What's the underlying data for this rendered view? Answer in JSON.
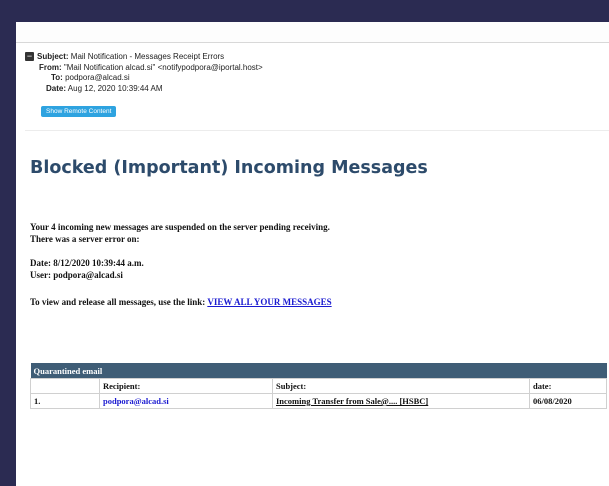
{
  "email": {
    "subject_label": "Subject:",
    "subject": "Mail Notification - Messages Receipt Errors",
    "from_label": "From:",
    "from": "\"Mail Notification alcad.si\" <notifypodpora@iportal.host>",
    "to_label": "To:",
    "to": "podpora@alcad.si",
    "date_label": "Date:",
    "date": "Aug 12, 2020 10:39:44 AM",
    "remote_button": "Show Remote Content",
    "collapse_glyph": "−"
  },
  "body": {
    "title": "Blocked (Important) Incoming Messages",
    "line1": "Your 4 incoming new messages are suspended on the server pending receiving.",
    "line2": "There was a server error on:",
    "date_line": "Date:   8/12/2020 10:39:44 a.m.",
    "user_line": "User: podpora@alcad.si",
    "link_prefix": "To view and release all messages, use the link:  ",
    "link_text": "VIEW ALL YOUR MESSAGES"
  },
  "table": {
    "caption": "Quarantined email",
    "columns": [
      "",
      "Recipient:",
      "Subject:",
      "date:"
    ],
    "rows": [
      [
        "1.",
        "podpora@alcad.si",
        "Incoming Transfer from Sale@.... [HSBC]",
        "06/08/2020"
      ]
    ]
  },
  "colors": {
    "background": "#2b2b52",
    "title": "#2d4b6b",
    "table_header": "#3f5d76",
    "link": "#1a1ad0",
    "button": "#2ea3e0"
  }
}
